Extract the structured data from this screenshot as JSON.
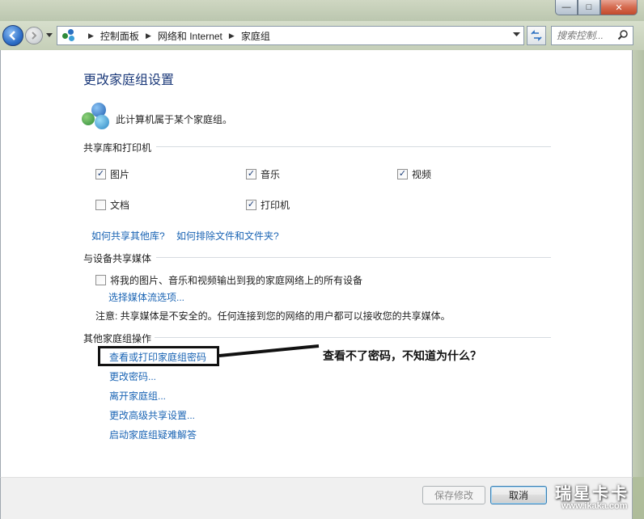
{
  "window": {
    "minimize_glyph": "—",
    "maximize_glyph": "□",
    "close_glyph": "✕"
  },
  "nav": {
    "breadcrumbs": [
      "控制面板",
      "网络和 Internet",
      "家庭组"
    ],
    "search_placeholder": "搜索控制..."
  },
  "page": {
    "title": "更改家庭组设置",
    "membership_text": "此计算机属于某个家庭组。"
  },
  "libraries_section": {
    "title": "共享库和打印机",
    "items": [
      {
        "label": "图片",
        "checked": true
      },
      {
        "label": "音乐",
        "checked": true
      },
      {
        "label": "视频",
        "checked": true
      },
      {
        "label": "文档",
        "checked": false
      },
      {
        "label": "打印机",
        "checked": true
      }
    ],
    "links": [
      "如何共享其他库?",
      "如何排除文件和文件夹?"
    ]
  },
  "media_section": {
    "title": "与设备共享媒体",
    "checkbox_label": "将我的图片、音乐和视频输出到我的家庭网络上的所有设备",
    "checkbox_checked": false,
    "stream_link": "选择媒体流选项...",
    "note": "注意: 共享媒体是不安全的。任何连接到您的网络的用户都可以接收您的共享媒体。"
  },
  "other_section": {
    "title": "其他家庭组操作",
    "links": [
      "查看或打印家庭组密码",
      "更改密码...",
      "离开家庭组...",
      "更改高级共享设置...",
      "启动家庭组疑难解答"
    ]
  },
  "annotation": {
    "callout": "查看不了密码，不知道为什么？"
  },
  "footer": {
    "save_label": "保存修改",
    "cancel_label": "取消"
  },
  "watermark": {
    "brand": "瑞星卡卡",
    "url": "www.ikaka.com"
  },
  "colors": {
    "link": "#1a64b4",
    "title": "#1c3a7a",
    "annotation": "#111111"
  }
}
